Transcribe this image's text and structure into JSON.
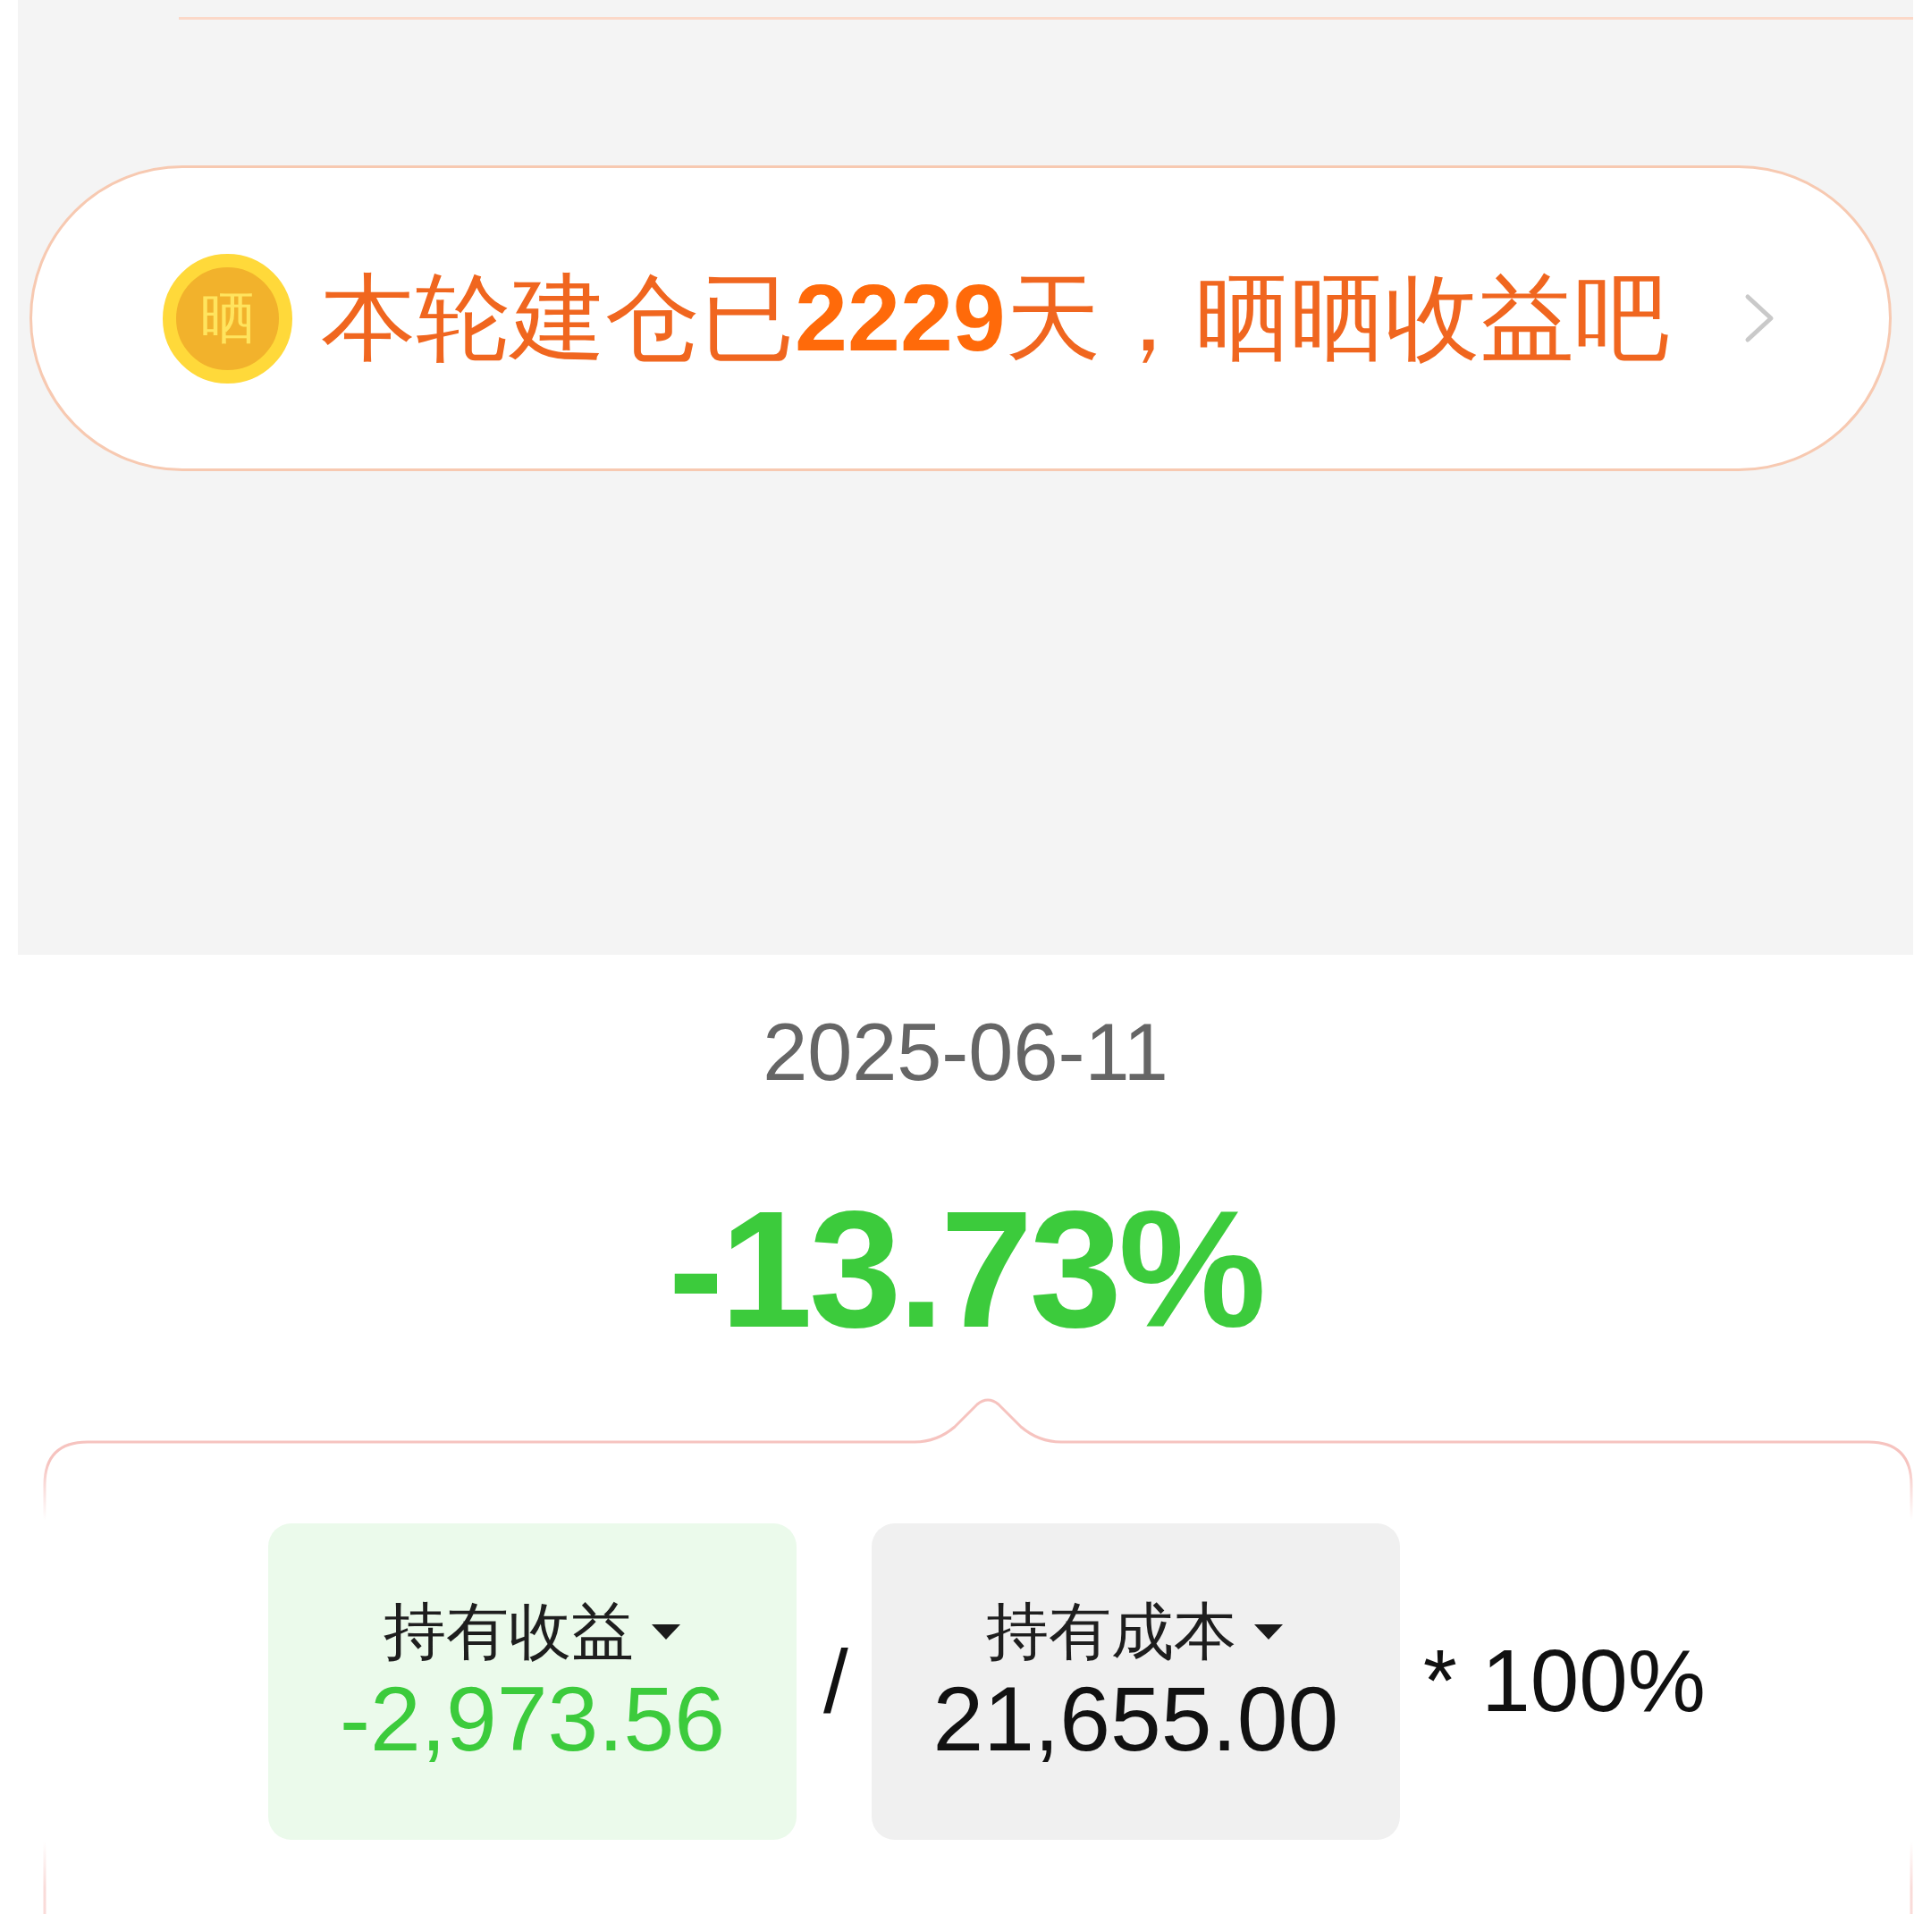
{
  "share_banner": {
    "badge": "晒",
    "text": "本轮建仓已**2229**天，晒晒收益吧"
  },
  "date": "2025-06-11",
  "return_rate": {
    "value": "-13.73%",
    "loss": true
  },
  "formula": {
    "terms": [
      {
        "label": "持有收益",
        "value": "-2,973.56",
        "color": "#3ccb3c"
      },
      {
        "label": "持有成本",
        "value": "21,655.00",
        "color": "#111111"
      }
    ],
    "operator": "/",
    "suffix": "* 100%"
  }
}
